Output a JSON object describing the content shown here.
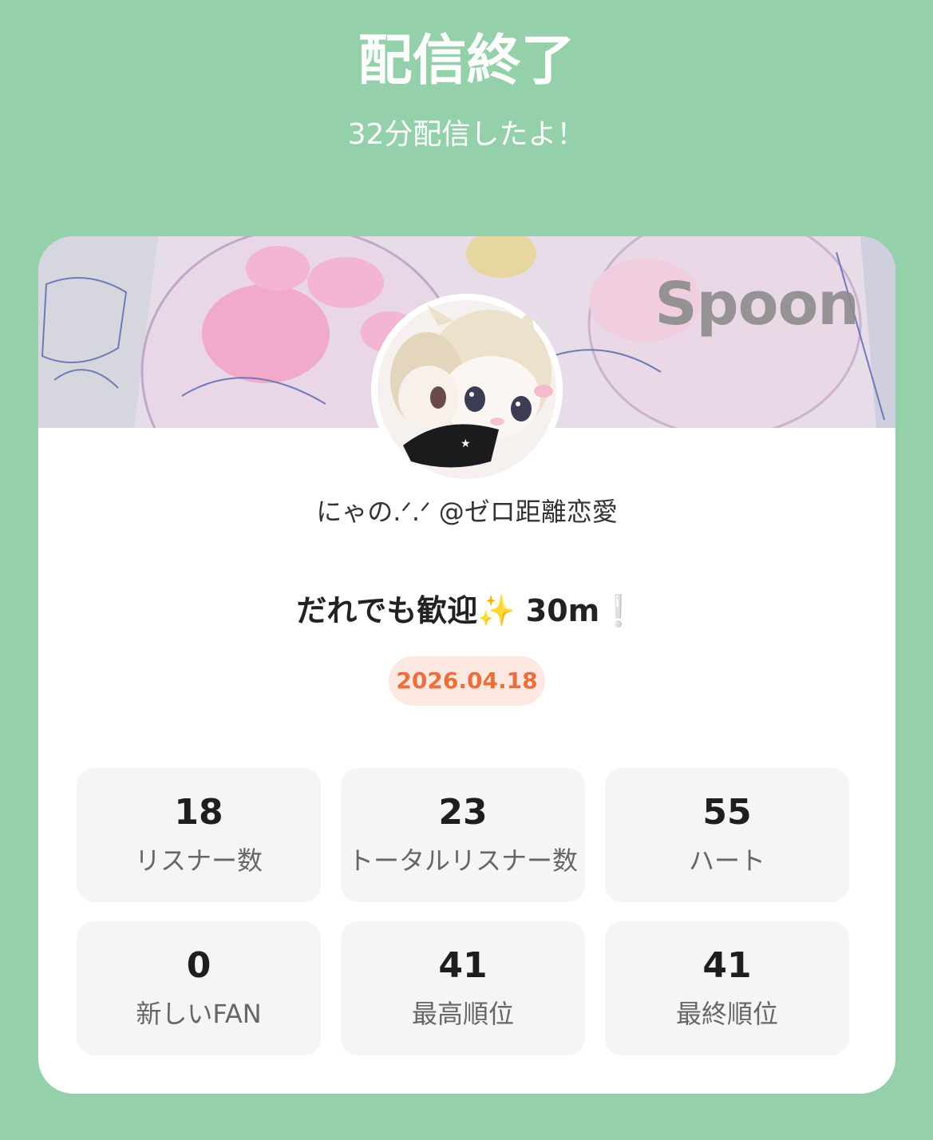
{
  "header": {
    "title": "配信終了",
    "subtitle": "32分配信したよ！"
  },
  "banner": {
    "brand": "Spoon",
    "avatar_icon": "user-avatar-illustration"
  },
  "profile": {
    "author": "にゃの.ᐟ.ᐟ @ゼロ距離恋愛"
  },
  "live": {
    "title": "だれでも歓迎✨ 30m❕",
    "date": "2026.04.18"
  },
  "stats": [
    {
      "value": "18",
      "label": "リスナー数"
    },
    {
      "value": "23",
      "label": "トータルリスナー数"
    },
    {
      "value": "55",
      "label": "ハート"
    },
    {
      "value": "0",
      "label": "新しいFAN"
    },
    {
      "value": "41",
      "label": "最高順位"
    },
    {
      "value": "41",
      "label": "最終順位"
    }
  ],
  "colors": {
    "background": "#94d1aa",
    "card": "#ffffff",
    "date_text": "#ea6f3c",
    "date_bg": "#fde8e1",
    "stat_bg": "#f5f5f5"
  }
}
